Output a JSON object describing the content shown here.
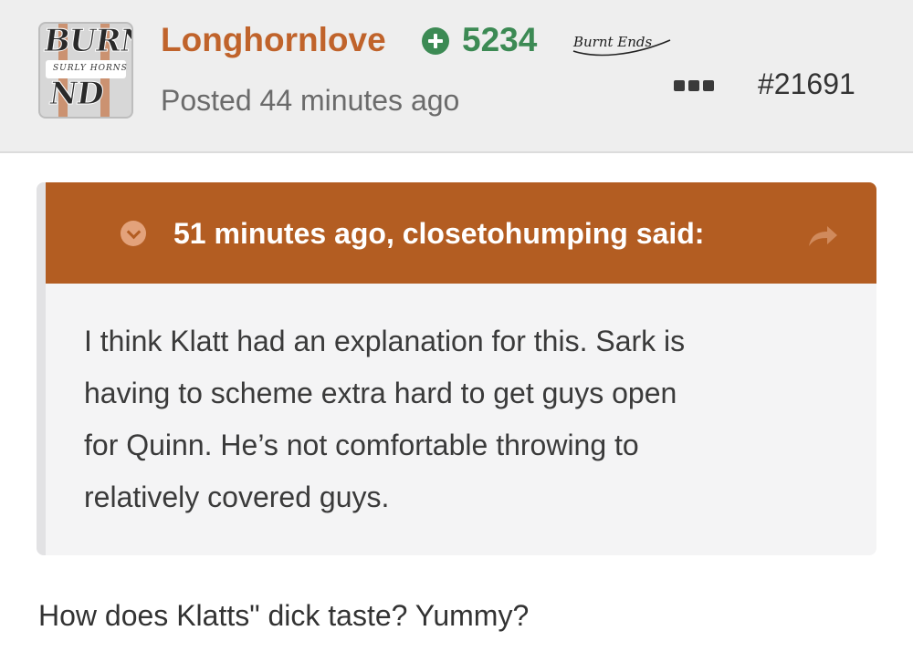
{
  "post": {
    "author": {
      "username": "Longhornlove",
      "reputation": "5234",
      "rank_badge": "Burnt Ends",
      "avatar_text_top": "BURN",
      "avatar_text_bottom": "ND",
      "avatar_script": "SURLY HORNS"
    },
    "posted_time": "Posted 44 minutes ago",
    "post_number": "#21691",
    "more_icon": "more-dots-icon",
    "quote": {
      "citation": "51 minutes ago, closetohumping said:",
      "toggle_icon": "chevron-down-circle-icon",
      "share_icon": "share-arrow-icon",
      "lines": [
        "I think Klatt had an explanation for this.  Sark is",
        "having to scheme extra hard to get guys open",
        "for Quinn.  He’s not comfortable throwing to",
        "relatively covered guys."
      ]
    },
    "reply": "How does Klatts\" dick taste? Yummy?"
  },
  "colors": {
    "accent_orange": "#b35d22",
    "username_orange": "#c0632b",
    "reputation_green": "#3c8a54",
    "header_bg": "#eeeeee",
    "quote_bg": "#f4f4f5"
  }
}
